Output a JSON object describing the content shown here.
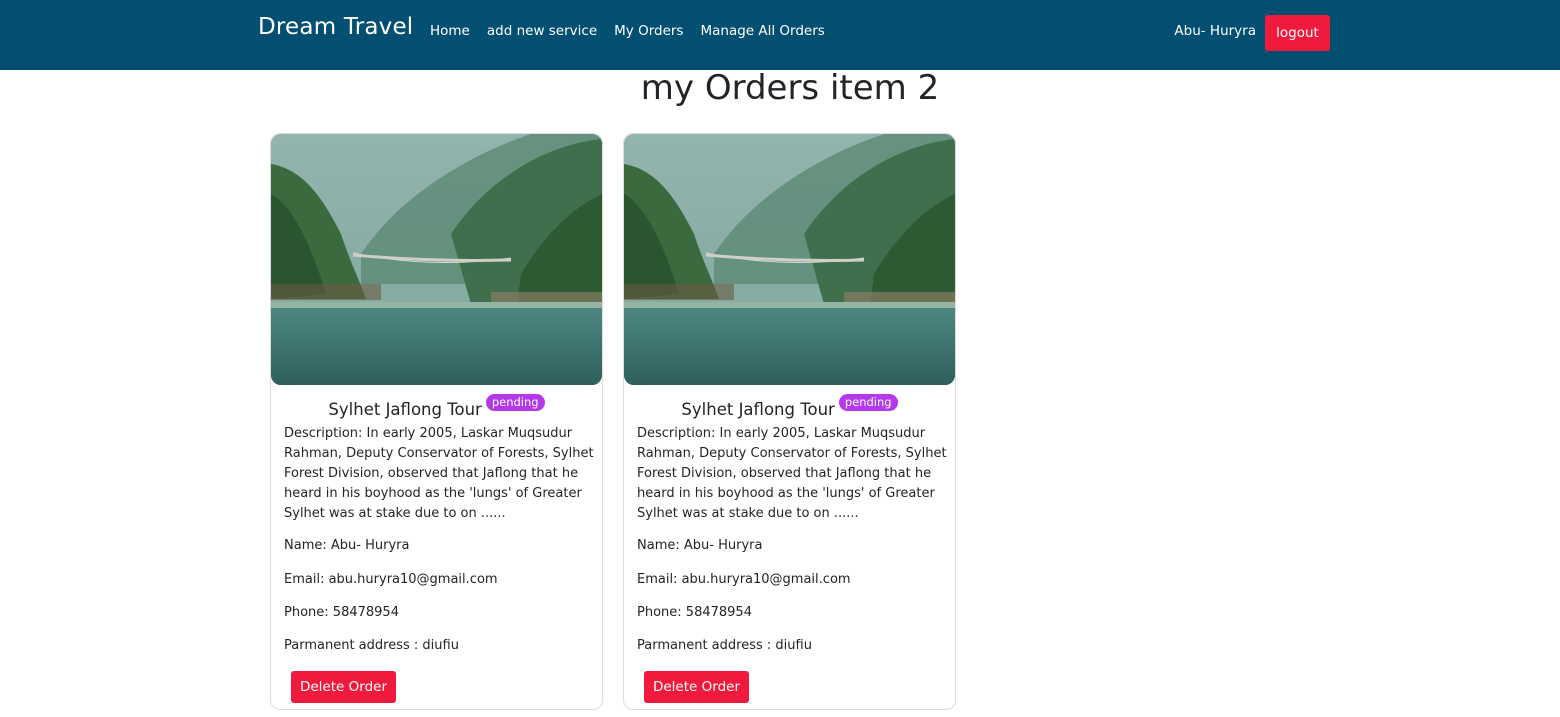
{
  "navbar": {
    "brand": "Dream Travel",
    "links": [
      "Home",
      "add new service",
      "My Orders",
      "Manage All Orders"
    ],
    "user_name": "Abu- Huryra",
    "logout_label": "logout"
  },
  "page": {
    "title": "my Orders item 2"
  },
  "orders": [
    {
      "title": "Sylhet Jaflong Tour",
      "status": "pending",
      "description": "Description: In early 2005, Laskar Muqsudur Rahman, Deputy Conservator of Forests, Sylhet Forest Division, observed that Jaflong that he heard in his boyhood as the 'lungs' of Greater Sylhet was at stake due to on ......",
      "name_label": "Name: ",
      "name": "Abu- Huryra",
      "email_label": "Email: ",
      "email": "abu.huryra10@gmail.com",
      "phone_label": "Phone: ",
      "phone": "58478954",
      "address_label": "Parmanent address : ",
      "address": "diufiu",
      "delete_label": "Delete Order"
    },
    {
      "title": "Sylhet Jaflong Tour",
      "status": "pending",
      "description": "Description: In early 2005, Laskar Muqsudur Rahman, Deputy Conservator of Forests, Sylhet Forest Division, observed that Jaflong that he heard in his boyhood as the 'lungs' of Greater Sylhet was at stake due to on ......",
      "name_label": "Name: ",
      "name": "Abu- Huryra",
      "email_label": "Email: ",
      "email": "abu.huryra10@gmail.com",
      "phone_label": "Phone: ",
      "phone": "58478954",
      "address_label": "Parmanent address : ",
      "address": "diufiu",
      "delete_label": "Delete Order"
    }
  ],
  "colors": {
    "navbar_bg": "#034f72",
    "danger": "#f01a3c",
    "badge": "#b339ea"
  }
}
